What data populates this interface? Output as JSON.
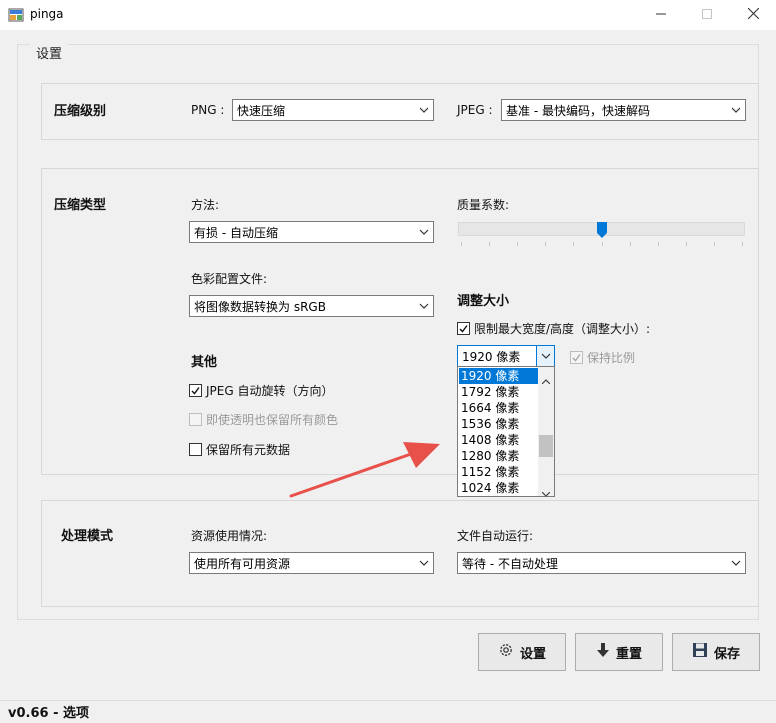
{
  "window": {
    "title": "pinga",
    "status": "v0.66 - 选项"
  },
  "settings_group": {
    "legend": "设置"
  },
  "compression_level": {
    "title": "压缩级别",
    "png_label": "PNG :",
    "png_value": "快速压缩",
    "jpeg_label": "JPEG :",
    "jpeg_value": "基准 - 最快编码，快速解码"
  },
  "compression_type": {
    "title": "压缩类型",
    "method_label": "方法:",
    "method_value": "有损 - 自动压缩",
    "quality_label": "质量系数:",
    "quality_level": 0.5,
    "color_profile_label": "色彩配置文件:",
    "color_profile_value": "将图像数据转换为 sRGB",
    "resize_title": "调整大小",
    "limit_label": "限制最大宽度/高度（调整大小）:",
    "limit_checked": true,
    "size_value": "1920 像素",
    "keep_ratio_label": "保持比例",
    "keep_ratio_checked": true,
    "other_title": "其他",
    "jpeg_rotate_label": "JPEG 自动旋转（方向）",
    "jpeg_rotate_checked": true,
    "keep_transparent_label": "即使透明也保留所有颜色",
    "keep_transparent_checked": false,
    "keep_metadata_label": "保留所有元数据",
    "keep_metadata_checked": false,
    "size_options": [
      "1920 像素",
      "1792 像素",
      "1664 像素",
      "1536 像素",
      "1408 像素",
      "1280 像素",
      "1152 像素",
      "1024 像素"
    ]
  },
  "processing_mode": {
    "title": "处理模式",
    "resource_label": "资源使用情况:",
    "resource_value": "使用所有可用资源",
    "auto_run_label": "文件自动运行:",
    "auto_run_value": "等待 - 不自动处理"
  },
  "buttons": {
    "settings": "设置",
    "reset": "重置",
    "save": "保存"
  },
  "colors": {
    "accent": "#0078d7",
    "arrow": "#e8504a"
  }
}
